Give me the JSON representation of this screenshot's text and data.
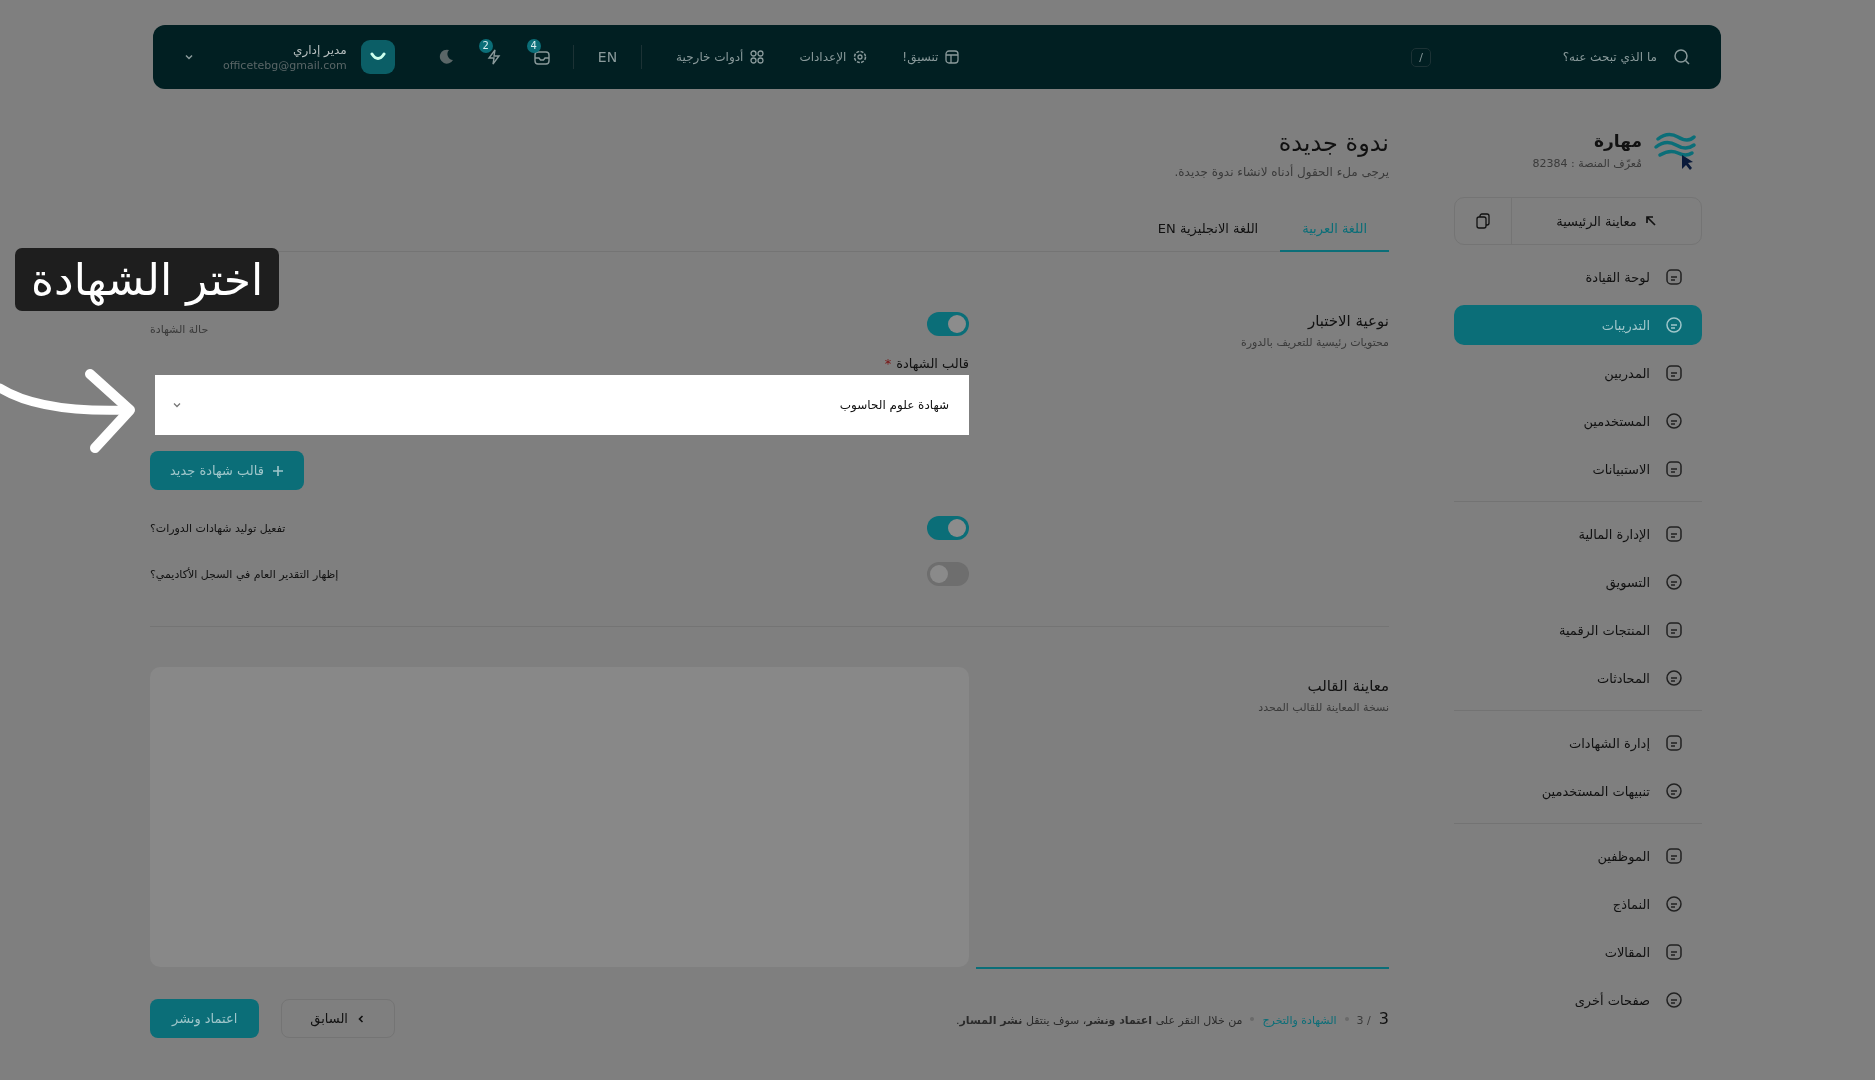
{
  "top_bar": {
    "search": {
      "placeholder": "ما الذي تبحث عنه؟",
      "shortcut": "/"
    },
    "links": [
      {
        "label": "تنسيق!"
      },
      {
        "label": "الإعدادات"
      },
      {
        "label": "أدوات خارجية"
      }
    ],
    "language": "EN",
    "badges": [
      {
        "count": "4"
      },
      {
        "count": "2"
      }
    ],
    "user": {
      "name": "مدير إداري",
      "email": "officetebg@gmail.com"
    }
  },
  "sidebar": {
    "brand": {
      "name": "مهارة",
      "platform_id": "مُعرّف المنصة : 82384"
    },
    "preview_button": "معاينة الرئيسية",
    "groups": [
      [
        {
          "label": "لوحة القيادة",
          "selected": false
        },
        {
          "label": "التدريبات",
          "selected": true
        },
        {
          "label": "المدربين",
          "selected": false
        },
        {
          "label": "المستخدمين",
          "selected": false
        },
        {
          "label": "الاستبيانات",
          "selected": false
        }
      ],
      [
        {
          "label": "الإدارة المالية",
          "selected": false
        },
        {
          "label": "التسويق",
          "selected": false
        },
        {
          "label": "المنتجات الرقمية",
          "selected": false
        },
        {
          "label": "المحادثات",
          "selected": false
        }
      ],
      [
        {
          "label": "إدارة الشهادات",
          "selected": false
        },
        {
          "label": "تنبيهات المستخدمين",
          "selected": false
        }
      ],
      [
        {
          "label": "الموظفين",
          "selected": false
        },
        {
          "label": "النماذج",
          "selected": false
        },
        {
          "label": "المقالات",
          "selected": false
        },
        {
          "label": "صفحات أخرى",
          "selected": false
        }
      ]
    ]
  },
  "page": {
    "title": "ندوة جديدة",
    "subtitle": "يرجى ملء الحقول أدناه لانشاء ندوة جديدة.",
    "tabs": [
      {
        "label": "اللغة العربية",
        "selected": true
      },
      {
        "label": "اللغة الانجليزية EN",
        "selected": false
      }
    ],
    "form": {
      "section": {
        "title": "نوعية الاختبار",
        "subtitle": "محتويات رئيسية للتعريف بالدورة"
      },
      "status": {
        "label": "حالة الشهادة",
        "on": true
      },
      "template": {
        "label": "قالب الشهادة",
        "required_mark": "*",
        "value": "شهادة علوم الحاسوب"
      },
      "new_template_button": "قالب شهادة جديد",
      "options": [
        {
          "label": "تفعيل توليد شهادات الدورات؟",
          "on": true
        },
        {
          "label": "إظهار التقدير العام في السجل الأكاديمي؟",
          "on": false
        }
      ]
    },
    "preview": {
      "title": "معاينة القالب",
      "subtitle": "نسخة المعاينة للقالب المحدد"
    },
    "footer": {
      "step": "3",
      "total": "/ 3",
      "step_name": "الشهادة والتخرج",
      "hint": "من خلال النقر على **اعتماد ونشر**، سوف ينتقل **نشر المسار**.",
      "buttons": [
        {
          "label": "السابق",
          "kind": "secondary"
        },
        {
          "label": "اعتماد ونشر",
          "kind": "primary"
        }
      ]
    }
  },
  "tooltip": "اختر الشهادة"
}
